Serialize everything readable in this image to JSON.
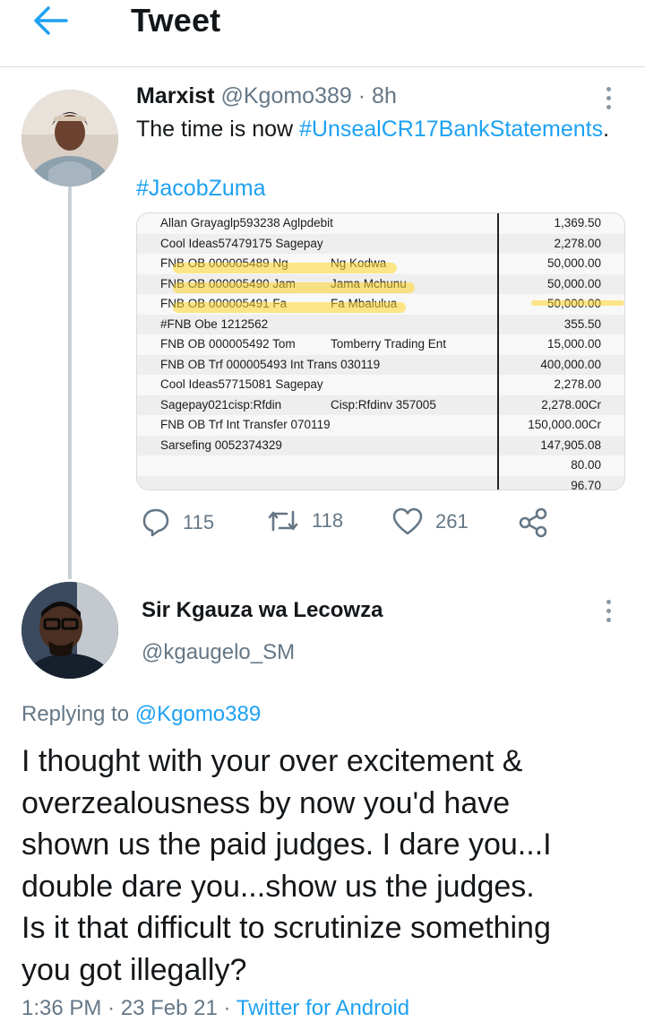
{
  "header": {
    "title": "Tweet",
    "back_icon": "arrow-left-icon"
  },
  "colors": {
    "accent": "#1da1f2",
    "muted": "#657786",
    "text": "#14171a",
    "highlight": "#ffd628"
  },
  "tweet": {
    "name": "Marxist",
    "handle": "@Kgomo389",
    "separator": "·",
    "time": "8h",
    "text_prefix": "The time is now ",
    "hashtag1": "#UnsealCR17BankStatements",
    "text_suffix": ".",
    "hashtag2": "#JacobZuma",
    "statement": {
      "rows": [
        {
          "desc": "Allan Grayaglp593238 Aglpdebit",
          "desc2": "",
          "amount": "1,369.50"
        },
        {
          "desc": "Cool Ideas57479175 Sagepay",
          "desc2": "",
          "amount": "2,278.00"
        },
        {
          "desc": "FNB OB 000005489 Ng",
          "desc2": "Ng Kodwa",
          "amount": "50,000.00"
        },
        {
          "desc": "FNB OB 000005490 Jam",
          "desc2": "Jama Mchunu",
          "amount": "50,000.00"
        },
        {
          "desc": "FNB OB 000005491 Fa",
          "desc2": "Fa Mbalulua",
          "amount": "50,000.00"
        },
        {
          "desc": "#FNB Obe  1212562",
          "desc2": "",
          "amount": "355.50"
        },
        {
          "desc": "FNB OB 000005492 Tom",
          "desc2": "Tomberry Trading Ent",
          "amount": "15,000.00"
        },
        {
          "desc": "FNB OB Trf 000005493 Int Trans 030119",
          "desc2": "",
          "amount": "400,000.00"
        },
        {
          "desc": "Cool Ideas57715081 Sagepay",
          "desc2": "",
          "amount": "2,278.00"
        },
        {
          "desc": "Sagepay021cisp:Rfdin",
          "desc2": "Cisp:Rfdinv 357005",
          "amount": "2,278.00Cr"
        },
        {
          "desc": "FNB OB Trf Int Transfer 070119",
          "desc2": "",
          "amount": "150,000.00Cr"
        },
        {
          "desc": "Sarsefing 0052374329",
          "desc2": "",
          "amount": "147,905.08"
        },
        {
          "desc": "",
          "desc2": "",
          "amount": "80.00"
        },
        {
          "desc": "",
          "desc2": "",
          "amount": "96.70"
        }
      ]
    },
    "actions": {
      "replies": "115",
      "retweets": "118",
      "likes": "261",
      "reply_icon": "reply-icon",
      "retweet_icon": "retweet-icon",
      "like_icon": "heart-icon",
      "share_icon": "share-icon"
    }
  },
  "reply": {
    "name": "Sir Kgauza wa Lecowza",
    "handle": "@kgaugelo_SM",
    "replying_label": "Replying to ",
    "replying_to": "@Kgomo389",
    "lines": [
      "I thought with your over excitement &",
      "overzealousness by now you'd have",
      "shown us the paid judges. I dare you...I",
      "double dare you...show us the judges.",
      "Is it that difficult to scrutinize something",
      "you got illegally?"
    ],
    "time": "1:36 PM",
    "date": "23 Feb 21",
    "separator": "·",
    "source": "Twitter for Android"
  }
}
